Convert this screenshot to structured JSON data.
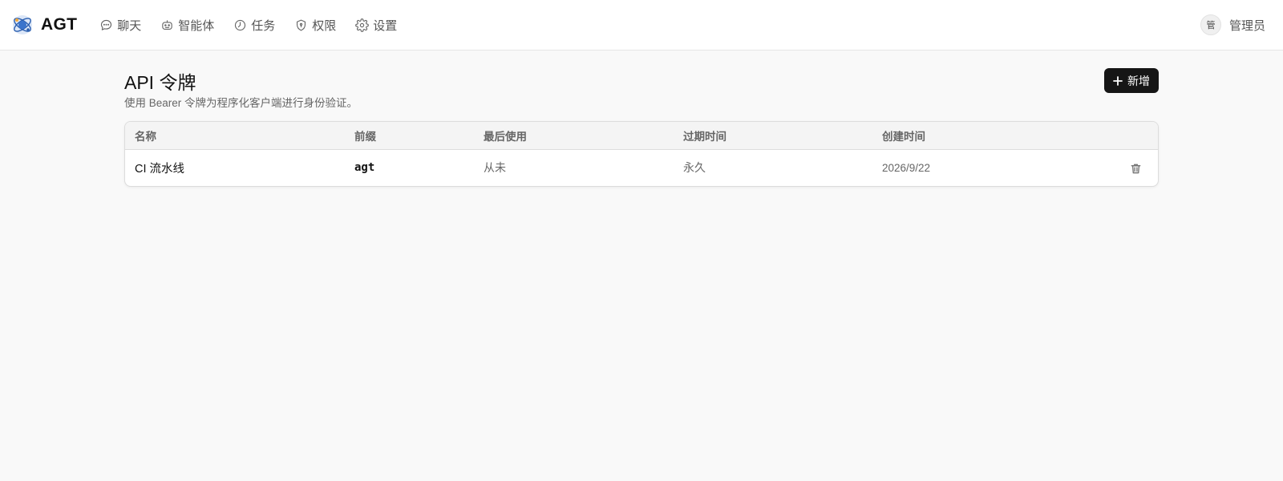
{
  "app": {
    "name": "AGT"
  },
  "nav": [
    {
      "label": "聊天",
      "icon": "chat-icon"
    },
    {
      "label": "智能体",
      "icon": "robot-icon"
    },
    {
      "label": "任务",
      "icon": "clock-icon"
    },
    {
      "label": "权限",
      "icon": "shield-icon"
    },
    {
      "label": "设置",
      "icon": "gear-icon"
    }
  ],
  "user": {
    "avatar_text": "管",
    "name": "管理员"
  },
  "page": {
    "title": "API 令牌",
    "subtitle": "使用 Bearer 令牌为程序化客户端进行身份验证。",
    "add_label": "新增"
  },
  "table": {
    "columns": [
      "名称",
      "前缀",
      "最后使用",
      "过期时间",
      "创建时间"
    ],
    "rows": [
      {
        "name": "CI 流水线",
        "prefix": "agt",
        "last_used": "从未",
        "expires": "永久",
        "created": "2026/9/22"
      }
    ]
  },
  "colors": {
    "primary_button": "#161616",
    "background": "#f9f9f9"
  }
}
